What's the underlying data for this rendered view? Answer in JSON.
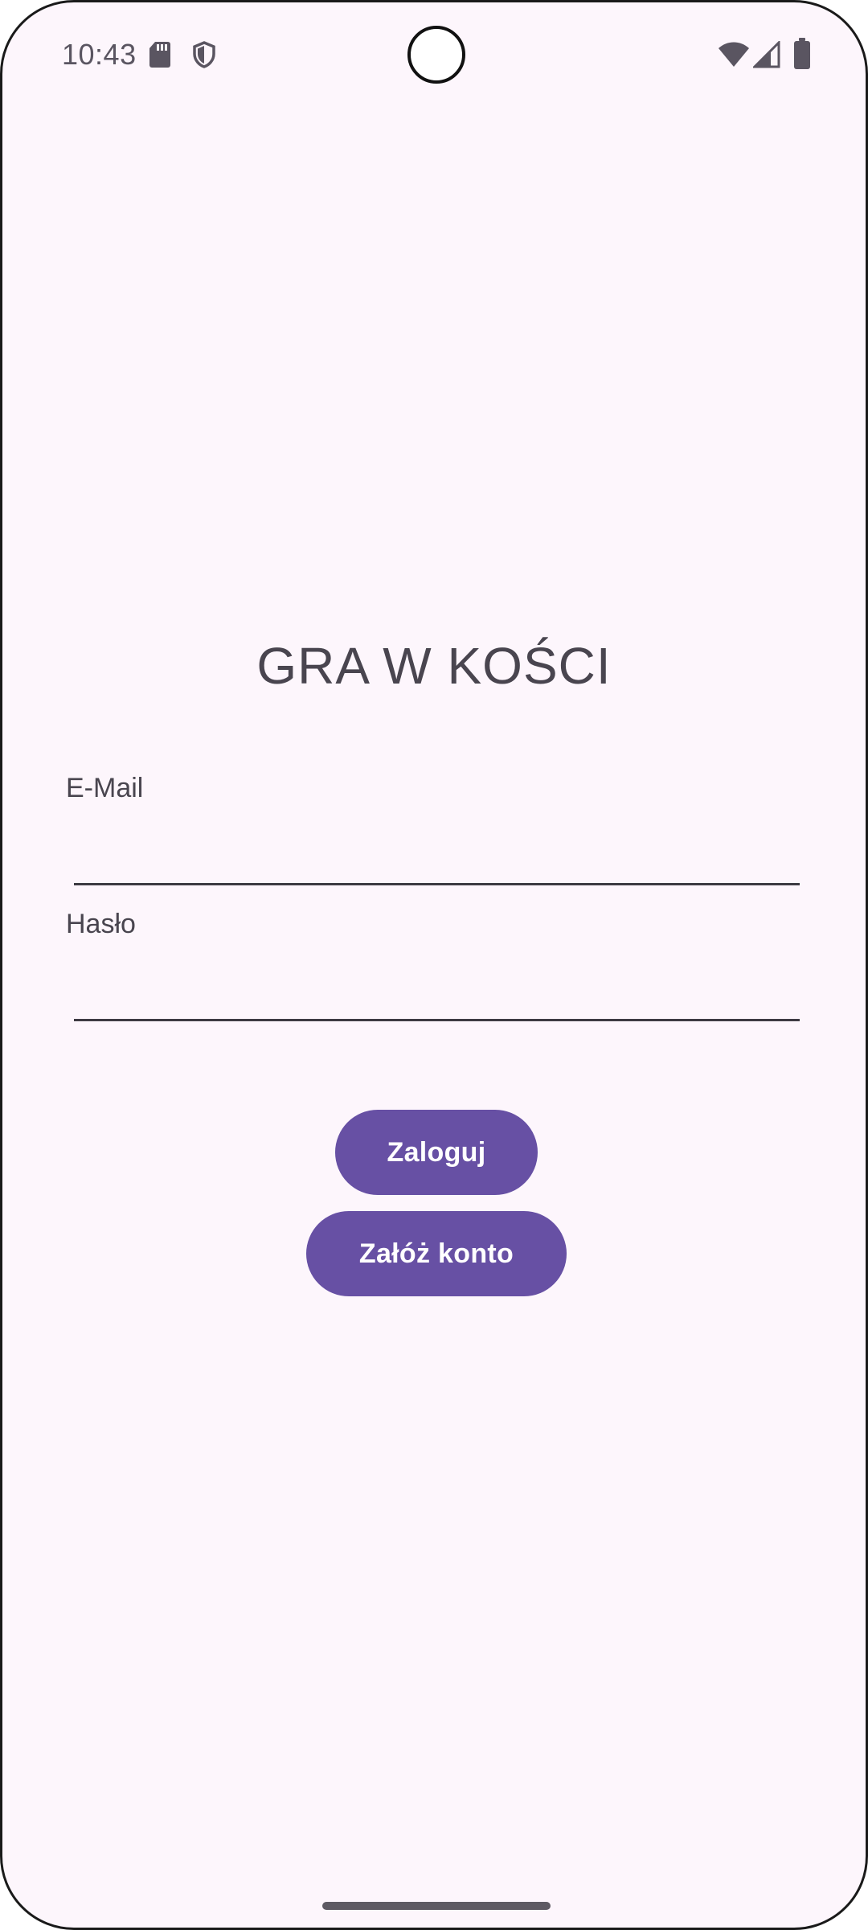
{
  "status_bar": {
    "time": "10:43",
    "icons": [
      "sd-card-icon",
      "shield-icon",
      "wifi-icon",
      "signal-icon",
      "battery-icon"
    ]
  },
  "screen": {
    "title": "GRA W KOŚCI",
    "email": {
      "label": "E-Mail",
      "value": ""
    },
    "password": {
      "label": "Hasło",
      "value": ""
    },
    "buttons": {
      "login": "Zaloguj",
      "register": "Załóż konto"
    }
  },
  "colors": {
    "background": "#fdf6fc",
    "primary": "#6750a4",
    "on_primary": "#ffffff",
    "text": "#49454f",
    "underline": "#3d3a42"
  }
}
